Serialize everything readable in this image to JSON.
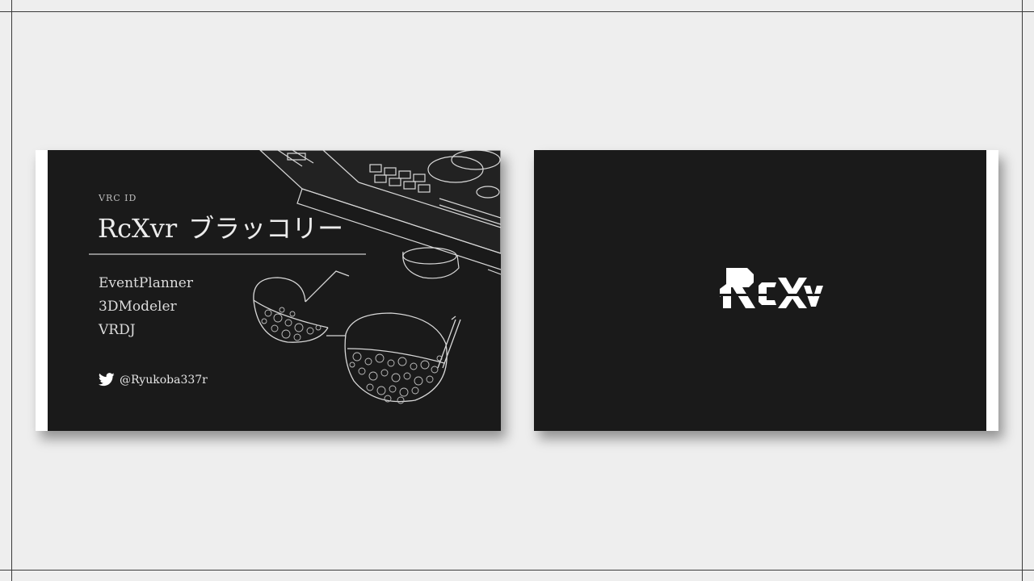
{
  "front": {
    "vrc_label": "VRC ID",
    "name_latin": "RcXvr",
    "name_jp": "ブラッコリー",
    "roles": [
      "EventPlanner",
      "3DModeler",
      "VRDJ"
    ],
    "twitter_handle": "@Ryukoba337r",
    "icons": {
      "social": "twitter-bird-icon"
    }
  },
  "back": {
    "logo_text": "RcXvr"
  },
  "colors": {
    "page_bg": "#eeeeee",
    "card_bg": "#1a1a1a",
    "card_text": "#ececec",
    "card_strip": "#ffffff"
  }
}
